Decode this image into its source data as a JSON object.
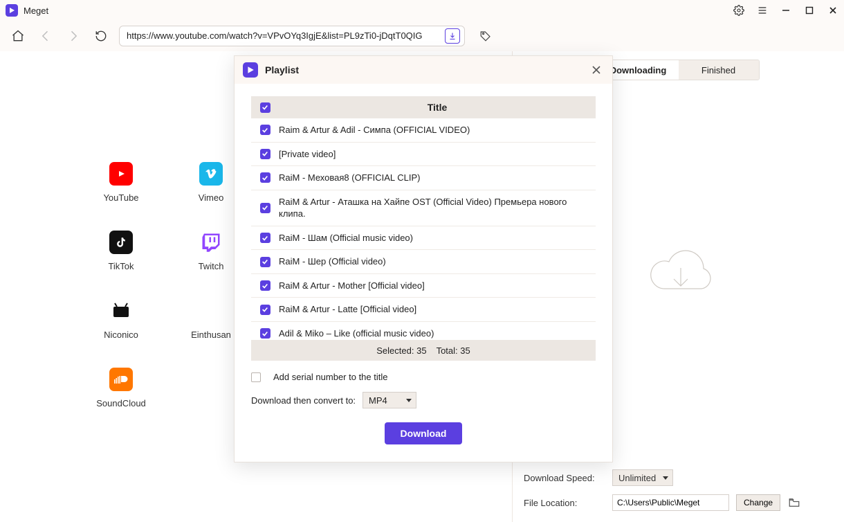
{
  "app": {
    "title": "Meget"
  },
  "toolbar": {
    "url": "https://www.youtube.com/watch?v=VPvOYq3IgjE&list=PL9zTi0-jDqtT0QIG"
  },
  "sources": [
    {
      "id": "youtube",
      "label": "YouTube"
    },
    {
      "id": "vimeo",
      "label": "Vimeo"
    },
    {
      "id": "tiktok",
      "label": "TikTok"
    },
    {
      "id": "twitch",
      "label": "Twitch"
    },
    {
      "id": "niconico",
      "label": "Niconico"
    },
    {
      "id": "einthusan",
      "label": "Einthusan"
    },
    {
      "id": "soundcloud",
      "label": "SoundCloud"
    },
    {
      "id": "add",
      "label": ""
    }
  ],
  "rightPane": {
    "tabs": {
      "downloading": "Downloading",
      "finished": "Finished"
    },
    "settings": {
      "speedLabel": "Download Speed:",
      "speedValue": "Unlimited",
      "locationLabel": "File Location:",
      "locationValue": "C:\\Users\\Public\\Meget",
      "changeLabel": "Change"
    }
  },
  "modal": {
    "title": "Playlist",
    "columnTitle": "Title",
    "items": [
      {
        "title": "Raim & Artur & Adil - Симпа (OFFICIAL VIDEO)"
      },
      {
        "title": "[Private video]"
      },
      {
        "title": "RaiM - Меховая8 (OFFICIAL CLIP)"
      },
      {
        "title": "RaiM & Artur - Аташка на Хайпе OST (Official Video) Премьера нового клипа."
      },
      {
        "title": "RaiM - Шам (Official music video)"
      },
      {
        "title": "RaiM - Шер (Official video)"
      },
      {
        "title": "RaiM & Artur - Mother [Official video]"
      },
      {
        "title": "RaiM & Artur - Latte [Official video]"
      },
      {
        "title": "Adil & Miko – Like (official music video)"
      }
    ],
    "selectedLabel": "Selected:",
    "selectedCount": "35",
    "totalLabel": "Total:",
    "totalCount": "35",
    "serialLabel": "Add serial number to the title",
    "convertLabel": "Download then convert to:",
    "convertValue": "MP4",
    "downloadLabel": "Download"
  }
}
